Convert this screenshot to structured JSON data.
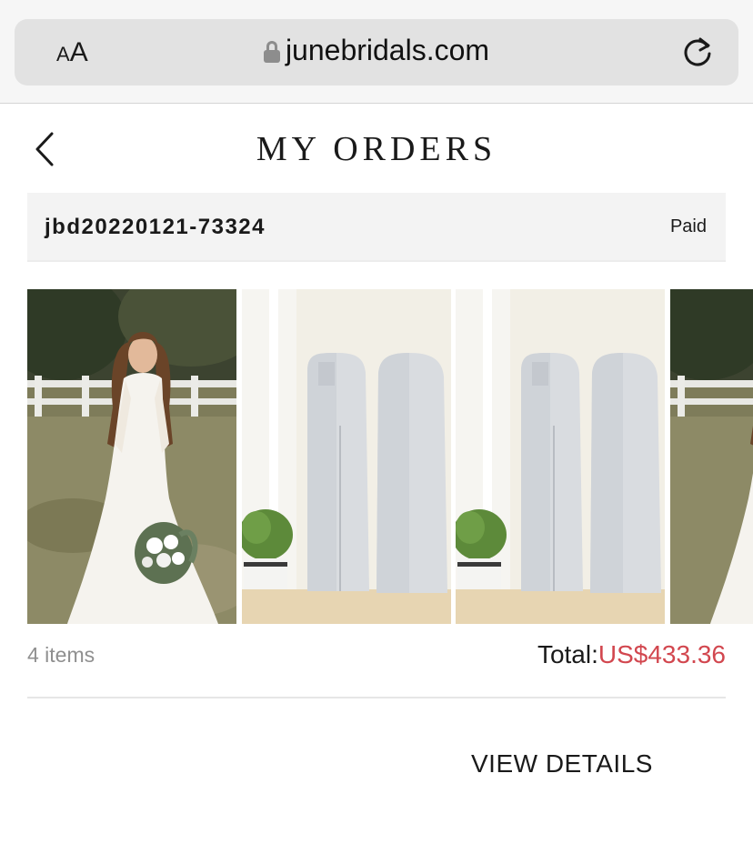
{
  "browser": {
    "text_size_small": "A",
    "text_size_large": "A",
    "url": "junebridals.com"
  },
  "header": {
    "title": "MY ORDERS"
  },
  "order": {
    "id": "jbd20220121-73324",
    "status": "Paid",
    "items": [
      {
        "icon": "bride-wedding-dress-photo"
      },
      {
        "icon": "garment-bag-photo"
      },
      {
        "icon": "garment-bag-photo"
      },
      {
        "icon": "bride-wedding-dress-photo"
      }
    ],
    "item_count": "4 items",
    "total_label": "Total:",
    "total_value": "US$433.36",
    "view_details": "VIEW DETAILS"
  },
  "colors": {
    "accent_price": "#d2474f",
    "order_header_bg": "#f3f3f3",
    "muted_text": "#8f8f8f"
  }
}
